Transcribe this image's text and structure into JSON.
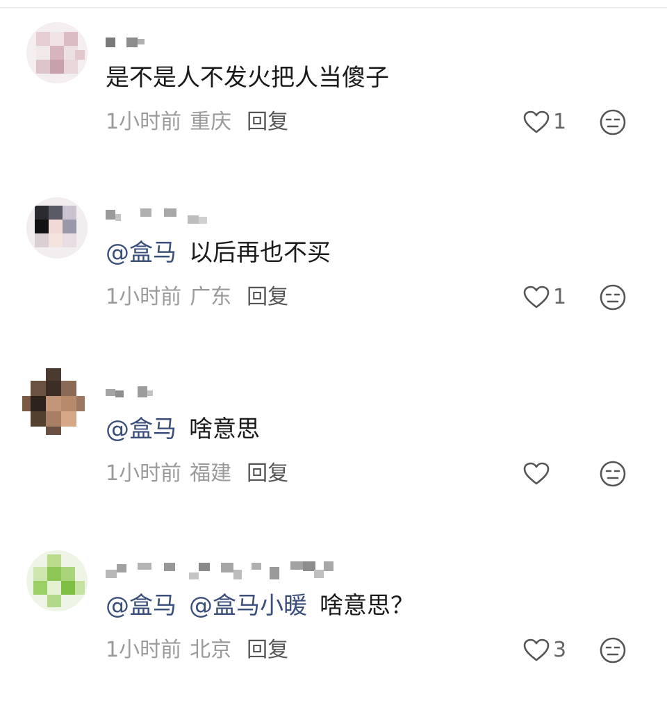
{
  "comments": [
    {
      "avatar_icon": "pixelated-avatar",
      "text_mentions": [],
      "text": "是不是人不发火把人当傻子",
      "time": "1小时前",
      "location": "重庆",
      "reply_label": "回复",
      "like_count": "1"
    },
    {
      "avatar_icon": "pixelated-avatar",
      "text_mentions": [
        "@盒马"
      ],
      "text": "以后再也不买",
      "time": "1小时前",
      "location": "广东",
      "reply_label": "回复",
      "like_count": "1"
    },
    {
      "avatar_icon": "pixelated-avatar",
      "text_mentions": [
        "@盒马"
      ],
      "text": "啥意思",
      "time": "1小时前",
      "location": "福建",
      "reply_label": "回复",
      "like_count": ""
    },
    {
      "avatar_icon": "pixelated-avatar",
      "text_mentions": [
        "@盒马",
        "@盒马小暖"
      ],
      "text": "啥意思？",
      "time": "1小时前",
      "location": "北京",
      "reply_label": "回复",
      "like_count": "3"
    }
  ],
  "colors": {
    "mention": "#3a4e7a",
    "meta": "#9a9a9a",
    "reply": "#555555",
    "icon": "#555555"
  }
}
